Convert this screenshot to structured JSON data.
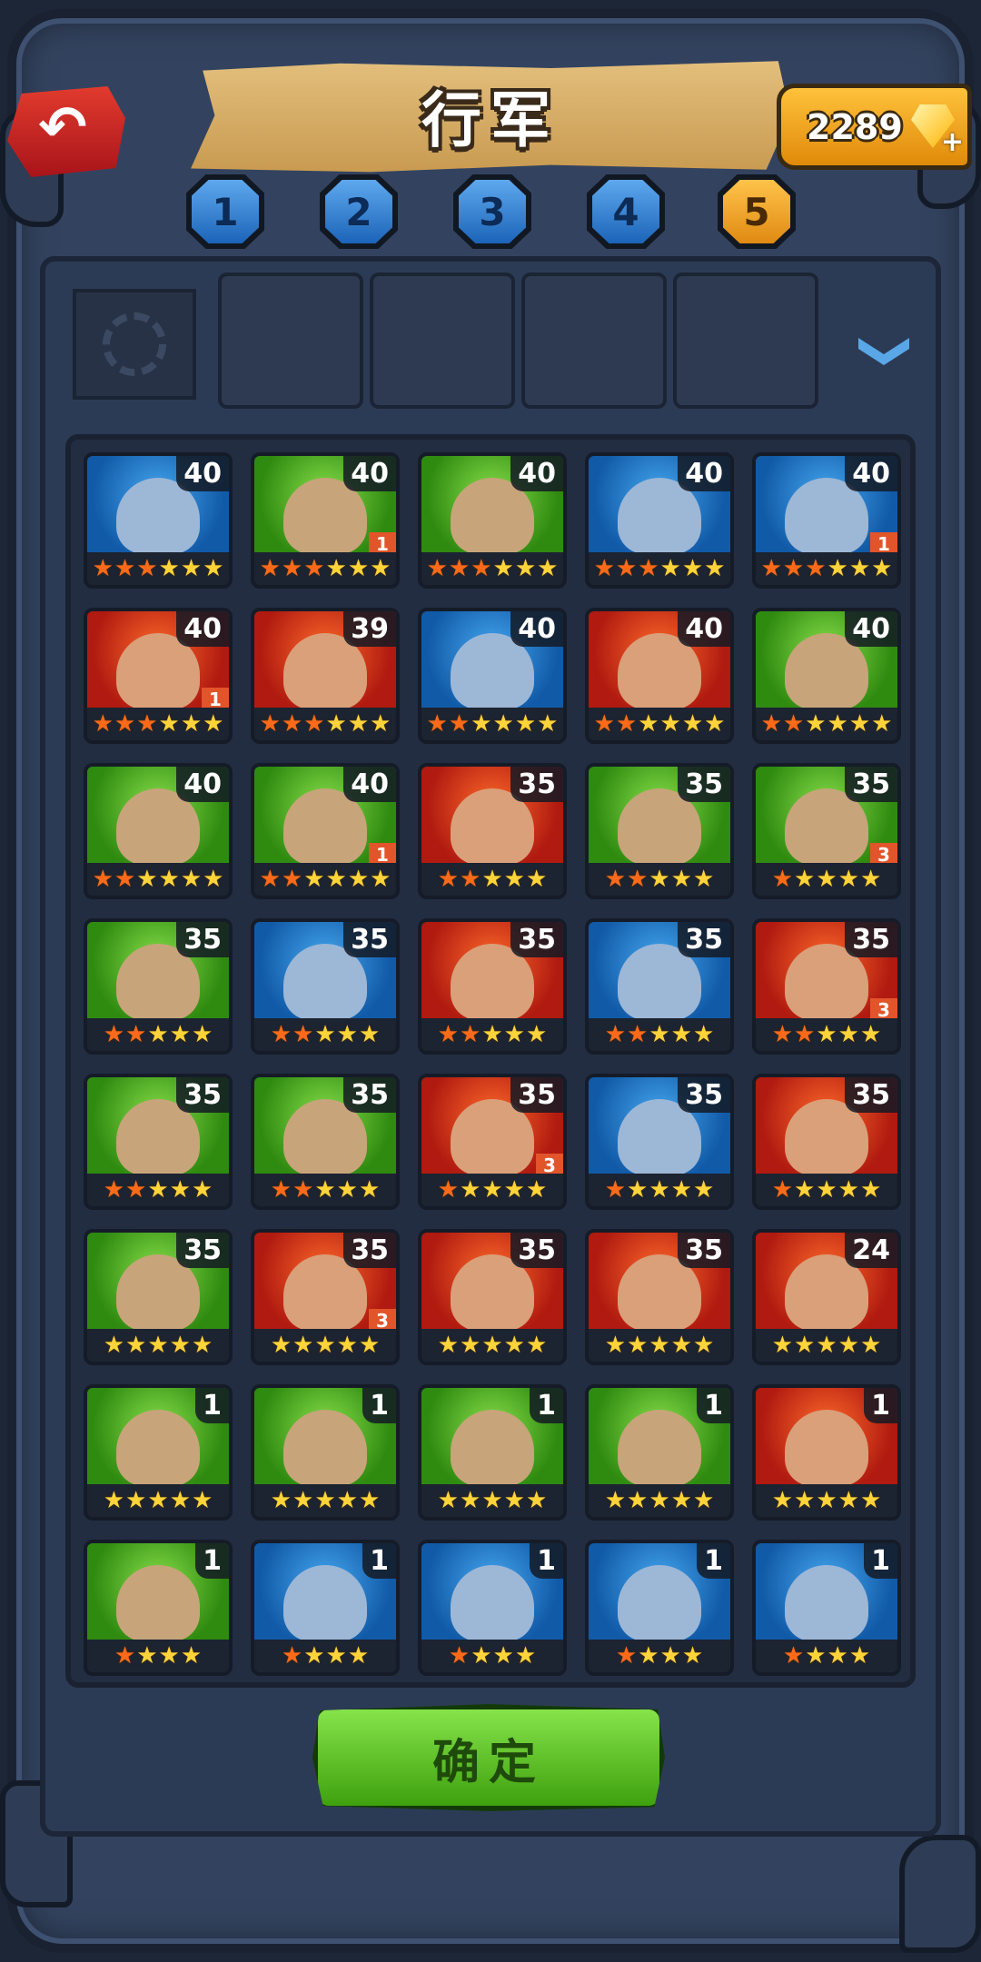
{
  "header": {
    "title": "行军",
    "gems": "2289",
    "back_icon": "back-arrow-icon",
    "gem_icon": "gem-icon"
  },
  "tabs": [
    {
      "label": "1",
      "active": false
    },
    {
      "label": "2",
      "active": false
    },
    {
      "label": "3",
      "active": false
    },
    {
      "label": "4",
      "active": false
    },
    {
      "label": "5",
      "active": true
    }
  ],
  "team_slots": {
    "emblem_icon": "swirl-emblem-icon",
    "empty_slots": 4
  },
  "heroes": [
    {
      "level": "40",
      "bg": "blue",
      "badge": "",
      "stars": 6,
      "red_stars": 3
    },
    {
      "level": "40",
      "bg": "green",
      "badge": "1",
      "stars": 6,
      "red_stars": 3
    },
    {
      "level": "40",
      "bg": "green",
      "badge": "",
      "stars": 6,
      "red_stars": 3
    },
    {
      "level": "40",
      "bg": "blue",
      "badge": "",
      "stars": 6,
      "red_stars": 3
    },
    {
      "level": "40",
      "bg": "blue",
      "badge": "1",
      "stars": 6,
      "red_stars": 3
    },
    {
      "level": "40",
      "bg": "red",
      "badge": "1",
      "stars": 6,
      "red_stars": 3
    },
    {
      "level": "39",
      "bg": "red",
      "badge": "",
      "stars": 6,
      "red_stars": 3
    },
    {
      "level": "40",
      "bg": "blue",
      "badge": "",
      "stars": 6,
      "red_stars": 2
    },
    {
      "level": "40",
      "bg": "red",
      "badge": "",
      "stars": 6,
      "red_stars": 2
    },
    {
      "level": "40",
      "bg": "green",
      "badge": "",
      "stars": 6,
      "red_stars": 2
    },
    {
      "level": "40",
      "bg": "green",
      "badge": "",
      "stars": 6,
      "red_stars": 2
    },
    {
      "level": "40",
      "bg": "green",
      "badge": "1",
      "stars": 6,
      "red_stars": 2
    },
    {
      "level": "35",
      "bg": "red",
      "badge": "",
      "stars": 5,
      "red_stars": 2
    },
    {
      "level": "35",
      "bg": "green",
      "badge": "",
      "stars": 5,
      "red_stars": 2
    },
    {
      "level": "35",
      "bg": "green",
      "badge": "3",
      "stars": 5,
      "red_stars": 1
    },
    {
      "level": "35",
      "bg": "green",
      "badge": "",
      "stars": 5,
      "red_stars": 2
    },
    {
      "level": "35",
      "bg": "blue",
      "badge": "",
      "stars": 5,
      "red_stars": 2
    },
    {
      "level": "35",
      "bg": "red",
      "badge": "",
      "stars": 5,
      "red_stars": 2
    },
    {
      "level": "35",
      "bg": "blue",
      "badge": "",
      "stars": 5,
      "red_stars": 2
    },
    {
      "level": "35",
      "bg": "red",
      "badge": "3",
      "stars": 5,
      "red_stars": 2
    },
    {
      "level": "35",
      "bg": "green",
      "badge": "",
      "stars": 5,
      "red_stars": 2
    },
    {
      "level": "35",
      "bg": "green",
      "badge": "",
      "stars": 5,
      "red_stars": 2
    },
    {
      "level": "35",
      "bg": "red",
      "badge": "3",
      "stars": 5,
      "red_stars": 1
    },
    {
      "level": "35",
      "bg": "blue",
      "badge": "",
      "stars": 5,
      "red_stars": 1
    },
    {
      "level": "35",
      "bg": "red",
      "badge": "",
      "stars": 5,
      "red_stars": 1
    },
    {
      "level": "35",
      "bg": "green",
      "badge": "",
      "stars": 5,
      "red_stars": 0
    },
    {
      "level": "35",
      "bg": "red",
      "badge": "3",
      "stars": 5,
      "red_stars": 0
    },
    {
      "level": "35",
      "bg": "red",
      "badge": "",
      "stars": 5,
      "red_stars": 0
    },
    {
      "level": "35",
      "bg": "red",
      "badge": "",
      "stars": 5,
      "red_stars": 0
    },
    {
      "level": "24",
      "bg": "red",
      "badge": "",
      "stars": 5,
      "red_stars": 0
    },
    {
      "level": "1",
      "bg": "green",
      "badge": "",
      "stars": 5,
      "red_stars": 0
    },
    {
      "level": "1",
      "bg": "green",
      "badge": "",
      "stars": 5,
      "red_stars": 0
    },
    {
      "level": "1",
      "bg": "green",
      "badge": "",
      "stars": 5,
      "red_stars": 0
    },
    {
      "level": "1",
      "bg": "green",
      "badge": "",
      "stars": 5,
      "red_stars": 0
    },
    {
      "level": "1",
      "bg": "red",
      "badge": "",
      "stars": 5,
      "red_stars": 0
    },
    {
      "level": "1",
      "bg": "green",
      "badge": "",
      "stars": 4,
      "red_stars": 1
    },
    {
      "level": "1",
      "bg": "blue",
      "badge": "",
      "stars": 4,
      "red_stars": 1
    },
    {
      "level": "1",
      "bg": "blue",
      "badge": "",
      "stars": 4,
      "red_stars": 1
    },
    {
      "level": "1",
      "bg": "blue",
      "badge": "",
      "stars": 4,
      "red_stars": 1
    },
    {
      "level": "1",
      "bg": "blue",
      "badge": "",
      "stars": 4,
      "red_stars": 1
    }
  ],
  "confirm_label": "确定"
}
